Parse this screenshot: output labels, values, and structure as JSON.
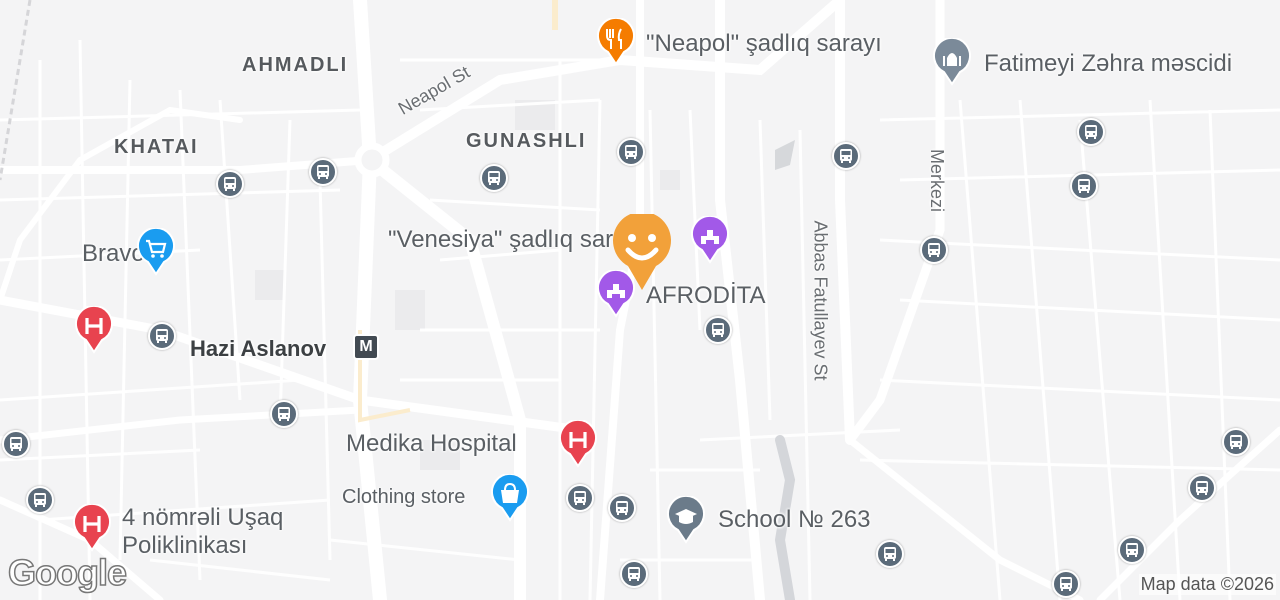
{
  "districts": {
    "ahmadli": "AHMADLI",
    "khatai": "KHATAI",
    "gunashli": "GUNASHLI"
  },
  "streets": {
    "neapol": "Neapol St",
    "abbas": "Abbas Fatullayev St",
    "merkazi": "Merkezi"
  },
  "places": {
    "neapol_hall": "\"Neapol\" şadlıq sarayı",
    "fatimeyi": "Fatimeyi Zəhra məscidi",
    "venesiya": "\"Venesiya\" şadlıq sarayı",
    "afrodita": "AFRODİTA",
    "bravo": "Bravo",
    "hazi_aslanov": "Hazi Aslanov",
    "medika": "Medika Hospital",
    "clothing": "Clothing store",
    "school": "School № 263",
    "polyclinic_line1": "4 nömrəli Uşaq",
    "polyclinic_line2": "Poliklinikası"
  },
  "metro_glyph": "M",
  "hospital_glyph": "H",
  "branding": {
    "logo": "Google",
    "attribution": "Map data ©2026"
  },
  "colors": {
    "background": "#f4f4f5",
    "road": "#ffffff",
    "food_pin": "#f57c00",
    "hospital_pin": "#e8434f",
    "shopping_pin": "#1a9cf0",
    "worship_pin": "#7b8a99",
    "venue_pin": "#a259e8",
    "school_pin": "#6b7b8a",
    "user_pin": "#f2a13a",
    "bus": "#5b6b7a"
  }
}
